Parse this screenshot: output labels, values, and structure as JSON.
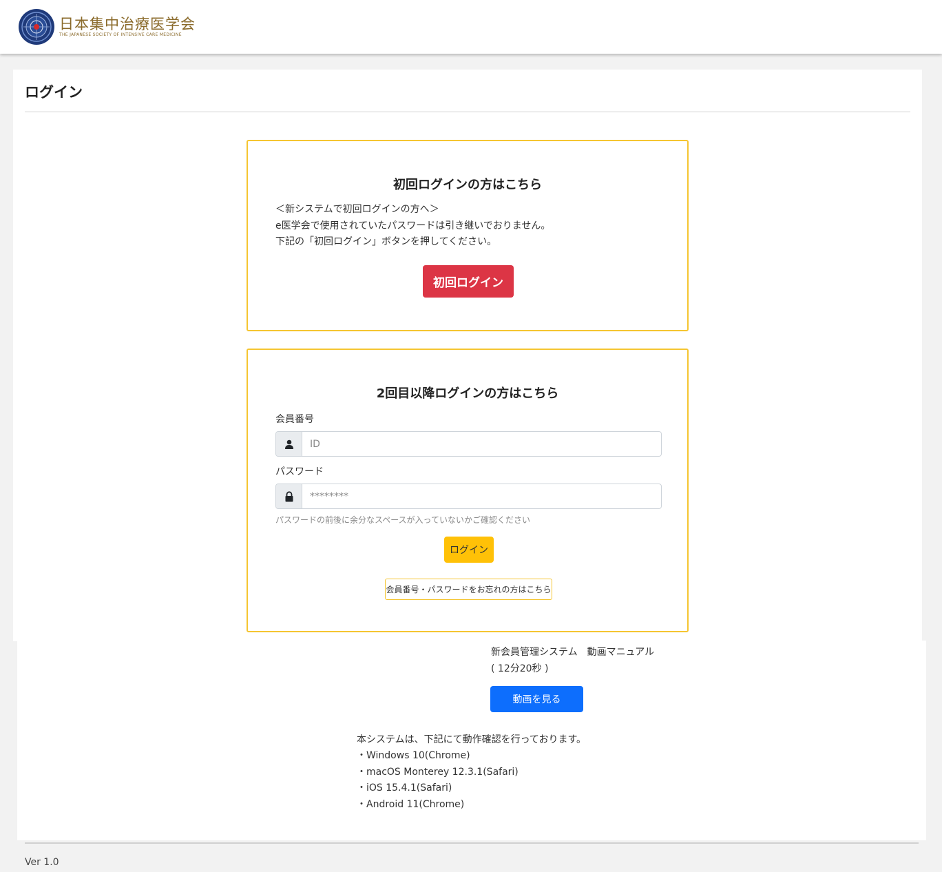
{
  "header": {
    "logo_jp": "日本集中治療医学会",
    "logo_en": "THE JAPANESE SOCIETY OF INTENSIVE CARE MEDICINE"
  },
  "page": {
    "title": "ログイン"
  },
  "first_login": {
    "heading": "初回ログインの方はこちら",
    "notice": [
      "＜新システムで初回ログインの方へ＞",
      "e医学会で使用されていたパスワードは引き継いでおりません。",
      "下記の「初回ログイン」ボタンを押してください。"
    ],
    "button_label": "初回ログイン"
  },
  "login": {
    "heading": "2回目以降ログインの方はこちら",
    "member_label": "会員番号",
    "member_placeholder": "ID",
    "password_label": "パスワード",
    "password_placeholder": "********",
    "hint": "パスワードの前後に余分なスペースが入っていないかご確認ください",
    "login_button": "ログイン",
    "forgot_button": "会員番号・パスワードをお忘れの方はこちら"
  },
  "video": {
    "title": "新会員管理システム　動画マニュアル",
    "duration": "( 12分20秒 )",
    "button": "動画を見る"
  },
  "compat": {
    "intro": "本システムは、下記にて動作確認を行っております。",
    "items": [
      "・Windows 10(Chrome)",
      "・macOS Monterey 12.3.1(Safari)",
      "・iOS 15.4.1(Safari)",
      "・Android 11(Chrome)"
    ]
  },
  "footer": {
    "version": "Ver 1.0"
  },
  "colors": {
    "accent_yellow": "#f5c531",
    "danger": "#dc3545",
    "warning": "#ffc107",
    "primary": "#0d6efd",
    "logo_gold": "#8a6a2a"
  },
  "icons": [
    "user-icon",
    "lock-icon"
  ]
}
